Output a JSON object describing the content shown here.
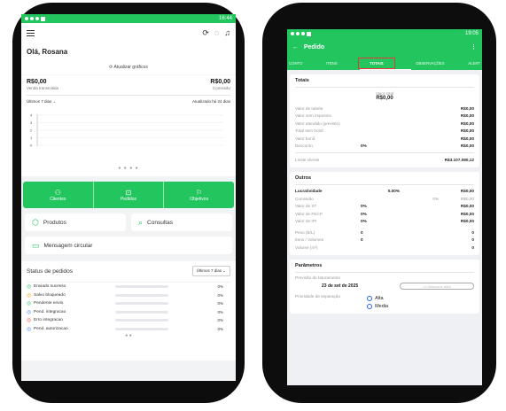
{
  "left": {
    "status_time": "16:44",
    "greeting": "Olá, Rosana",
    "update_charts": "Atualizar gráficos",
    "sales": {
      "left_value": "R$0,00",
      "right_value": "R$0,00",
      "left_label": "Venda transmitida",
      "right_label": "Comissão"
    },
    "filter_period": "Últimos 7 dias",
    "updated": "Atualizado há 24 dias",
    "chart_data": {
      "type": "line",
      "y_ticks": [
        "4",
        "3",
        "2",
        "1",
        "0"
      ],
      "ylim": [
        0,
        4
      ]
    },
    "green_tabs": [
      {
        "label": "Clientes",
        "icon": "users-icon"
      },
      {
        "label": "Pedidos",
        "icon": "bag-icon"
      },
      {
        "label": "Objetivos",
        "icon": "flag-icon"
      }
    ],
    "products": "Produtos",
    "queries": "Consultas",
    "circular": "Mensagem circular",
    "status_title": "Status de pedidos",
    "status_filter": "Últimos 7 dias",
    "status_rows": [
      {
        "label": "Enviado sucesso",
        "pct": "0%",
        "color": "#22c55e"
      },
      {
        "label": "Salvo bloqueado",
        "pct": "0%",
        "color": "#f59e0b"
      },
      {
        "label": "Pendente envio",
        "pct": "0%",
        "color": "#22c55e"
      },
      {
        "label": "Pend. integracao",
        "pct": "0%",
        "color": "#3b82f6"
      },
      {
        "label": "Erro integracao",
        "pct": "0%",
        "color": "#ef4444"
      },
      {
        "label": "Pend. autorizacao",
        "pct": "0%",
        "color": "#3b82f6"
      }
    ]
  },
  "right": {
    "status_time": "19:05",
    "title": "Pedido",
    "tabs": [
      "CONTO",
      "ITENS",
      "TOTAIS",
      "OBSERVAÇÕES",
      "ALERT"
    ],
    "totais": {
      "heading": "Totais",
      "valor_total_label": "Valor total",
      "valor_total": "R$0,00",
      "rows": [
        {
          "label": "Valor de tabela",
          "value": "R$0,00"
        },
        {
          "label": "Valor sem impostos",
          "value": "R$0,00"
        },
        {
          "label": "Valor atendido (previsto)",
          "value": "R$0,00"
        },
        {
          "label": "Total sem bonif.",
          "value": "R$0,00"
        },
        {
          "label": "Valor bonif.",
          "value": "R$0,00"
        }
      ],
      "desconto_label": "Desconto",
      "desconto_pct": "0%",
      "desconto_value": "R$0,00",
      "limite_label": "Limite cliente",
      "limite_value": "R$3.107.080,12"
    },
    "outros": {
      "heading": "Outros",
      "lucratividade": {
        "label": "Lucratividade",
        "pct": "0.00%",
        "value": "R$0,00"
      },
      "comissao": {
        "label": "Comissão",
        "pct": "0%",
        "value": "R$0,00"
      },
      "taxes": [
        {
          "label": "Valor de ST",
          "pct": "0%",
          "value": "R$0,00"
        },
        {
          "label": "Valor de FECP",
          "pct": "0%",
          "value": "R$0,00"
        },
        {
          "label": "Valor de IPI",
          "pct": "0%",
          "value": "R$0,00"
        }
      ],
      "peso": {
        "label": "Peso (B/L)",
        "a": "0",
        "b": "0"
      },
      "itens": {
        "label": "Itens / Volumes",
        "a": "0",
        "b": "0"
      },
      "volume": {
        "label": "Volume (m³)",
        "b": "0"
      }
    },
    "parametros": {
      "heading": "Parâmetros",
      "previsao_label": "Previsão de faturamento",
      "previsao_date": "23 de set de 2025",
      "date_placeholder": "Selecione data",
      "prioridade_label": "Prioridade de separação",
      "options": [
        "Alta",
        "Media"
      ]
    }
  }
}
